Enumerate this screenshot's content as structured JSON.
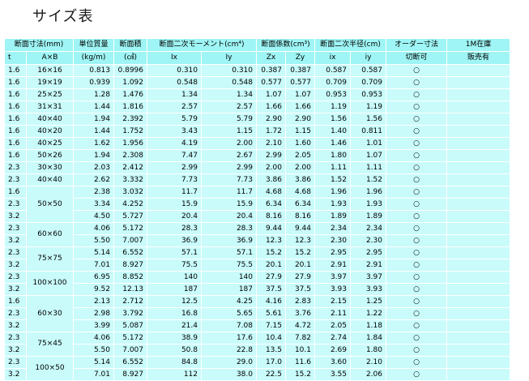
{
  "title": "サイズ表",
  "headers": {
    "dim": "断面寸法(mm)",
    "t": "t",
    "axb": "A×B",
    "unit_mass": "単位質量",
    "unit_mass_unit": "(kg/m)",
    "area": "断面積",
    "area_unit": "(㎠)",
    "moment": "断面二次モーメント(cm⁴)",
    "ix": "Ix",
    "iy": "Iy",
    "modulus": "断面係数(cm³)",
    "zx": "Zx",
    "zy": "Zy",
    "radius": "断面二次半径(cm)",
    "ixr": "ix",
    "iyr": "iy",
    "order": "オーダー寸法",
    "order2": "切断可",
    "stock": "1M在庫",
    "stock2": "販売有"
  },
  "rows": [
    {
      "t": "1.6",
      "ab": "16×16",
      "span": 1,
      "mass": "0.813",
      "area": "0.8996",
      "ix": "0.310",
      "iy": "0.310",
      "zx": "0.387",
      "zy": "0.387",
      "rx": "0.587",
      "ry": "0.587",
      "order": "○",
      "stock": ""
    },
    {
      "t": "1.6",
      "ab": "19×19",
      "span": 1,
      "mass": "0.939",
      "area": "1.092",
      "ix": "0.548",
      "iy": "0.548",
      "zx": "0.577",
      "zy": "0.577",
      "rx": "0.709",
      "ry": "0.709",
      "order": "○",
      "stock": ""
    },
    {
      "t": "1.6",
      "ab": "25×25",
      "span": 1,
      "mass": "1.28",
      "area": "1.476",
      "ix": "1.34",
      "iy": "1.34",
      "zx": "1.07",
      "zy": "1.07",
      "rx": "0.953",
      "ry": "0.953",
      "order": "○",
      "stock": ""
    },
    {
      "t": "1.6",
      "ab": "31×31",
      "span": 1,
      "mass": "1.44",
      "area": "1.816",
      "ix": "2.57",
      "iy": "2.57",
      "zx": "1.66",
      "zy": "1.66",
      "rx": "1.19",
      "ry": "1.19",
      "order": "○",
      "stock": ""
    },
    {
      "t": "1.6",
      "ab": "40×40",
      "span": 1,
      "mass": "1.94",
      "area": "2.392",
      "ix": "5.79",
      "iy": "5.79",
      "zx": "2.90",
      "zy": "2.90",
      "rx": "1.56",
      "ry": "1.56",
      "order": "○",
      "stock": ""
    },
    {
      "t": "1.6",
      "ab": "40×20",
      "span": 1,
      "mass": "1.44",
      "area": "1.752",
      "ix": "3.43",
      "iy": "1.15",
      "zx": "1.72",
      "zy": "1.15",
      "rx": "1.40",
      "ry": "0.811",
      "order": "○",
      "stock": ""
    },
    {
      "t": "1.6",
      "ab": "40×25",
      "span": 1,
      "mass": "1.62",
      "area": "1.956",
      "ix": "4.19",
      "iy": "2.00",
      "zx": "2.10",
      "zy": "1.60",
      "rx": "1.46",
      "ry": "1.01",
      "order": "○",
      "stock": ""
    },
    {
      "t": "1.6",
      "ab": "50×26",
      "span": 1,
      "mass": "1.94",
      "area": "2.308",
      "ix": "7.47",
      "iy": "2.67",
      "zx": "2.99",
      "zy": "2.05",
      "rx": "1.80",
      "ry": "1.07",
      "order": "○",
      "stock": ""
    },
    {
      "t": "2.3",
      "ab": "30×30",
      "span": 1,
      "mass": "2.03",
      "area": "2.412",
      "ix": "2.99",
      "iy": "2.99",
      "zx": "2.00",
      "zy": "2.00",
      "rx": "1.11",
      "ry": "1.11",
      "order": "○",
      "stock": ""
    },
    {
      "t": "2.3",
      "ab": "40×40",
      "span": 1,
      "mass": "2.62",
      "area": "3.332",
      "ix": "7.73",
      "iy": "7.73",
      "zx": "3.86",
      "zy": "3.86",
      "rx": "1.52",
      "ry": "1.52",
      "order": "○",
      "stock": ""
    },
    {
      "t": "1.6",
      "ab": "50×50",
      "span": 3,
      "mass": "2.38",
      "area": "3.032",
      "ix": "11.7",
      "iy": "11.7",
      "zx": "4.68",
      "zy": "4.68",
      "rx": "1.96",
      "ry": "1.96",
      "order": "○",
      "stock": ""
    },
    {
      "t": "2.3",
      "ab": null,
      "mass": "3.34",
      "area": "4.252",
      "ix": "15.9",
      "iy": "15.9",
      "zx": "6.34",
      "zy": "6.34",
      "rx": "1.93",
      "ry": "1.93",
      "order": "○",
      "stock": ""
    },
    {
      "t": "3.2",
      "ab": null,
      "mass": "4.50",
      "area": "5.727",
      "ix": "20.4",
      "iy": "20.4",
      "zx": "8.16",
      "zy": "8.16",
      "rx": "1.89",
      "ry": "1.89",
      "order": "○",
      "stock": ""
    },
    {
      "t": "2.3",
      "ab": "60×60",
      "span": 2,
      "mass": "4.06",
      "area": "5.172",
      "ix": "28.3",
      "iy": "28.3",
      "zx": "9.44",
      "zy": "9.44",
      "rx": "2.34",
      "ry": "2.34",
      "order": "○",
      "stock": ""
    },
    {
      "t": "3.2",
      "ab": null,
      "mass": "5.50",
      "area": "7.007",
      "ix": "36.9",
      "iy": "36.9",
      "zx": "12.3",
      "zy": "12.3",
      "rx": "2.30",
      "ry": "2.30",
      "order": "○",
      "stock": ""
    },
    {
      "t": "2.3",
      "ab": "75×75",
      "span": 2,
      "mass": "5.14",
      "area": "6.552",
      "ix": "57.1",
      "iy": "57.1",
      "zx": "15.2",
      "zy": "15.2",
      "rx": "2.95",
      "ry": "2.95",
      "order": "○",
      "stock": ""
    },
    {
      "t": "3.2",
      "ab": null,
      "mass": "7.01",
      "area": "8.927",
      "ix": "75.5",
      "iy": "75.5",
      "zx": "20.1",
      "zy": "20.1",
      "rx": "2.91",
      "ry": "2.91",
      "order": "○",
      "stock": ""
    },
    {
      "t": "2.3",
      "ab": "100×100",
      "span": 2,
      "mass": "6.95",
      "area": "8.852",
      "ix": "140",
      "iy": "140",
      "zx": "27.9",
      "zy": "27.9",
      "rx": "3.97",
      "ry": "3.97",
      "order": "○",
      "stock": ""
    },
    {
      "t": "3.2",
      "ab": null,
      "mass": "9.52",
      "area": "12.13",
      "ix": "187",
      "iy": "187",
      "zx": "37.5",
      "zy": "37.5",
      "rx": "3.93",
      "ry": "3.93",
      "order": "○",
      "stock": ""
    },
    {
      "t": "1.6",
      "ab": "60×30",
      "span": 3,
      "mass": "2.13",
      "area": "2.712",
      "ix": "12.5",
      "iy": "4.25",
      "zx": "4.16",
      "zy": "2.83",
      "rx": "2.15",
      "ry": "1.25",
      "order": "○",
      "stock": ""
    },
    {
      "t": "2.3",
      "ab": null,
      "mass": "2.98",
      "area": "3.792",
      "ix": "16.8",
      "iy": "5.65",
      "zx": "5.61",
      "zy": "3.76",
      "rx": "2.11",
      "ry": "1.22",
      "order": "○",
      "stock": ""
    },
    {
      "t": "3.2",
      "ab": null,
      "mass": "3.99",
      "area": "5.087",
      "ix": "21.4",
      "iy": "7.08",
      "zx": "7.15",
      "zy": "4.72",
      "rx": "2.05",
      "ry": "1.18",
      "order": "○",
      "stock": ""
    },
    {
      "t": "2.3",
      "ab": "75×45",
      "span": 2,
      "mass": "4.06",
      "area": "5.172",
      "ix": "38.9",
      "iy": "17.6",
      "zx": "10.4",
      "zy": "7.82",
      "rx": "2.74",
      "ry": "1.84",
      "order": "○",
      "stock": ""
    },
    {
      "t": "3.2",
      "ab": null,
      "mass": "5.50",
      "area": "7.007",
      "ix": "50.8",
      "iy": "22.8",
      "zx": "13.5",
      "zy": "10.1",
      "rx": "2.69",
      "ry": "1.80",
      "order": "○",
      "stock": ""
    },
    {
      "t": "2.3",
      "ab": "100×50",
      "span": 2,
      "mass": "5.14",
      "area": "6.552",
      "ix": "84.8",
      "iy": "29.0",
      "zx": "17.0",
      "zy": "11.6",
      "rx": "3.60",
      "ry": "2.10",
      "order": "○",
      "stock": ""
    },
    {
      "t": "3.2",
      "ab": null,
      "mass": "7.01",
      "area": "8.927",
      "ix": "112",
      "iy": "38.0",
      "zx": "22.5",
      "zy": "15.2",
      "rx": "3.55",
      "ry": "2.06",
      "order": "○",
      "stock": ""
    }
  ]
}
